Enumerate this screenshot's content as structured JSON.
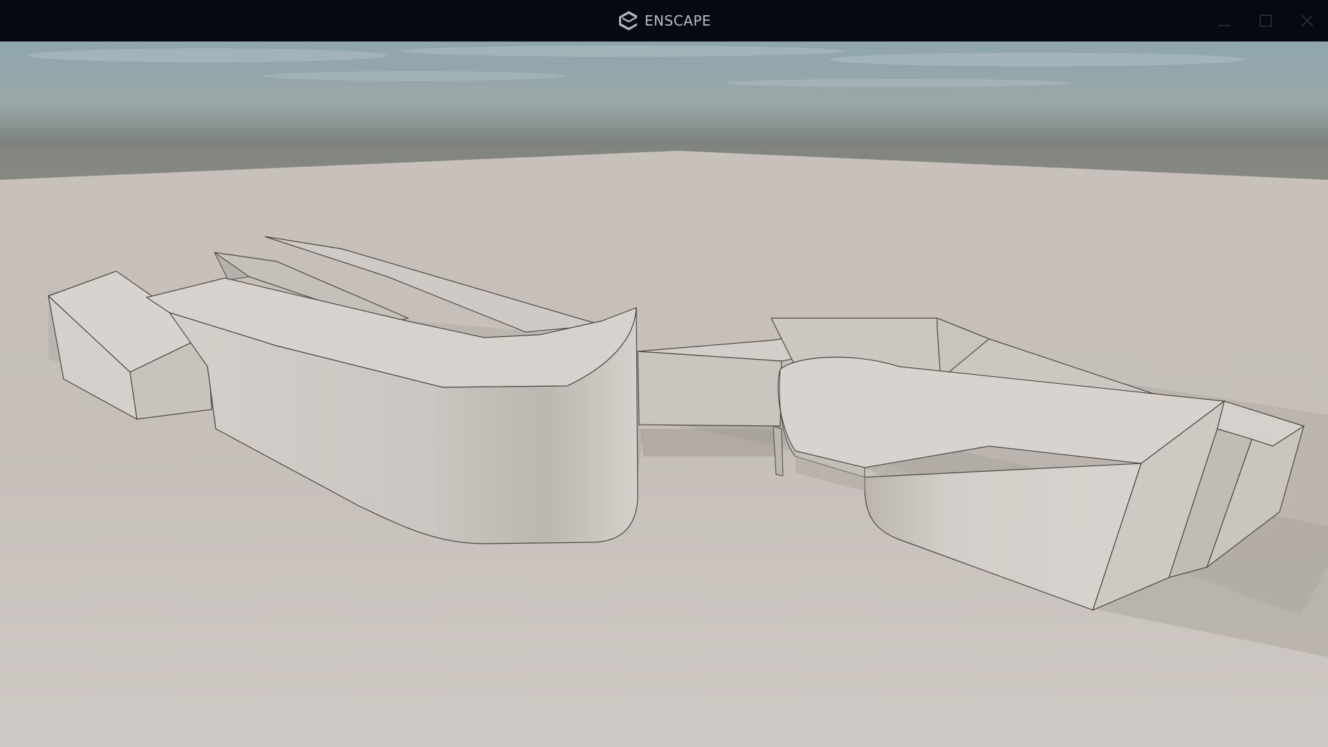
{
  "app": {
    "name": "ENSCAPE",
    "logo_icon": "enscape-logo-icon"
  },
  "window_controls": {
    "minimize": "minimize-icon",
    "maximize": "maximize-icon",
    "close": "close-icon"
  },
  "colors": {
    "titlebar": "#070911",
    "brand_text": "#b9bccb",
    "sky_top": "#8fa4ad",
    "ground": "#c9c3bf",
    "building": "#d9d4cf"
  }
}
